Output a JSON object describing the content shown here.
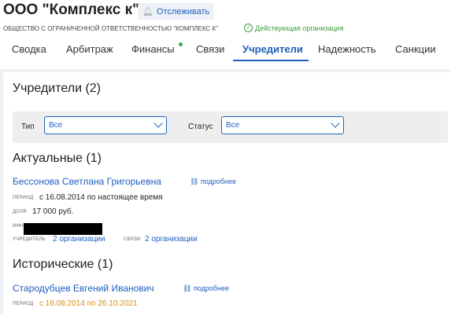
{
  "company": {
    "title": "ООО \"Комплекс к\"",
    "full_name": "ОБЩЕСТВО С ОГРАНИЧЕННОЙ ОТВЕТСТВЕННОСТЬЮ \"КОМПЛЕКС К\"",
    "status": "Действующая организация"
  },
  "track_button": {
    "label": "Отслеживать",
    "icon": "bell-icon"
  },
  "tabs": [
    {
      "label": "Сводка"
    },
    {
      "label": "Арбитраж"
    },
    {
      "label": "Финансы",
      "has_dot": true
    },
    {
      "label": "Связи"
    },
    {
      "label": "Учредители",
      "active": true
    },
    {
      "label": "Надежность"
    },
    {
      "label": "Санкции"
    }
  ],
  "section": {
    "title": "Учредители (2)",
    "filters": {
      "type_label": "Тип",
      "type_value": "Все",
      "status_label": "Статус",
      "status_value": "Все"
    }
  },
  "current": {
    "title": "Актуальные (1)",
    "person": {
      "name": "Бессонова Светлана Григорьевна",
      "more": "подробнее",
      "period_label": "ПЕРИОД",
      "period_value": "с 16.08.2014 по настоящее время",
      "share_label": "ДОЛЯ",
      "share_value": "17 000 руб.",
      "inn_label": "ИНН",
      "founder_label": "УЧРЕДИТЕЛЬ",
      "founder_value": "2 организации",
      "links_label": "СВЯЗИ",
      "links_value": "2 организации"
    }
  },
  "historical": {
    "title": "Исторические (1)",
    "person": {
      "name": "Стародубцев Евгений Иванович",
      "more": "подробнее",
      "period_label": "ПЕРИОД",
      "period_value": "с 16.08.2014 по 26.10.2021"
    }
  },
  "colors": {
    "accent": "#1f5fbf",
    "ok": "#3c9d3c",
    "warning": "#d98d10",
    "dot": "#2bb24c"
  }
}
